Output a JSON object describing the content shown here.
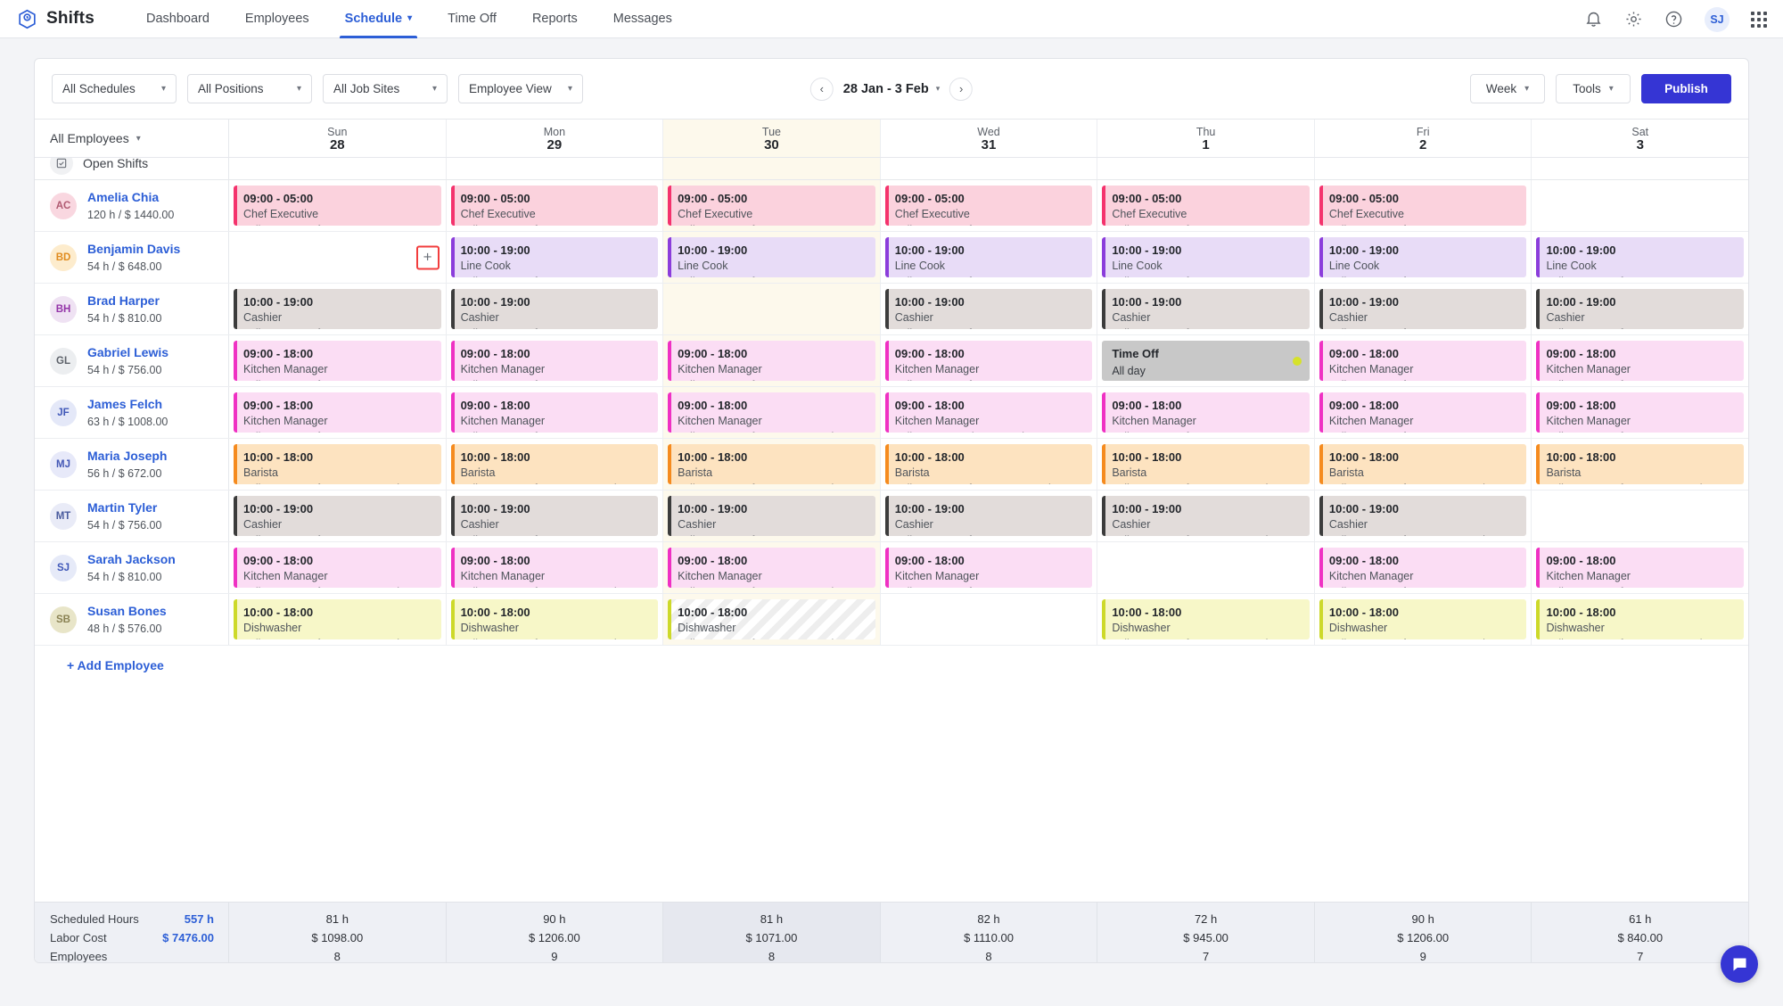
{
  "app": {
    "name": "Shifts",
    "logo_icon": "shifts-logo-icon"
  },
  "nav": {
    "items": [
      {
        "label": "Dashboard",
        "active": false,
        "caret": false
      },
      {
        "label": "Employees",
        "active": false,
        "caret": false
      },
      {
        "label": "Schedule",
        "active": true,
        "caret": true
      },
      {
        "label": "Time Off",
        "active": false,
        "caret": false
      },
      {
        "label": "Reports",
        "active": false,
        "caret": false
      },
      {
        "label": "Messages",
        "active": false,
        "caret": false
      }
    ],
    "right": {
      "bell_icon": "bell-icon",
      "settings_icon": "gear-icon",
      "help_icon": "help-circle-icon",
      "avatar_initials": "SJ",
      "apps_icon": "apps-grid-icon"
    }
  },
  "filters": {
    "schedules": "All Schedules",
    "positions": "All Positions",
    "job_sites": "All Job Sites",
    "view": "Employee View",
    "prev_icon": "chevron-left-icon",
    "next_icon": "chevron-right-icon",
    "date_range": "28 Jan - 3 Feb",
    "period": "Week",
    "tools": "Tools",
    "publish": "Publish"
  },
  "grid": {
    "employee_filter": "All Employees",
    "open_shifts_label": "Open Shifts",
    "add_employee": "+ Add Employee",
    "add_shift_icon": "plus-icon",
    "days": [
      {
        "name": "Sun",
        "date": "28",
        "today": false
      },
      {
        "name": "Mon",
        "date": "29",
        "today": false
      },
      {
        "name": "Tue",
        "date": "30",
        "today": true
      },
      {
        "name": "Wed",
        "date": "31",
        "today": false
      },
      {
        "name": "Thu",
        "date": "1",
        "today": false
      },
      {
        "name": "Fri",
        "date": "2",
        "today": false
      },
      {
        "name": "Sat",
        "date": "3",
        "today": false
      }
    ],
    "employees": [
      {
        "initials": "AC",
        "name": "Amelia Chia",
        "meta": "120 h / $ 1440.00",
        "avatar_bg": "#f9d7e0",
        "avatar_fg": "#b05a72",
        "cells": [
          {
            "time": "09:00 - 05:00",
            "position": "Chef Executive",
            "site": "Zylker Group of Restaurants, Aust",
            "bg": "#fbd2dd",
            "bar": "#f4336d"
          },
          {
            "time": "09:00 - 05:00",
            "position": "Chef Executive",
            "site": "Zylker Group of Restaurants, Aust",
            "bg": "#fbd2dd",
            "bar": "#f4336d"
          },
          {
            "time": "09:00 - 05:00",
            "position": "Chef Executive",
            "site": "Zylker Group of Restaurants, Aust",
            "bg": "#fbd2dd",
            "bar": "#f4336d"
          },
          {
            "time": "09:00 - 05:00",
            "position": "Chef Executive",
            "site": "Zylker Group of Restaurants, Aust",
            "bg": "#fbd2dd",
            "bar": "#f4336d"
          },
          {
            "time": "09:00 - 05:00",
            "position": "Chef Executive",
            "site": "Zylker Group of Restaurants, Aust",
            "bg": "#fbd2dd",
            "bar": "#f4336d"
          },
          {
            "time": "09:00 - 05:00",
            "position": "Chef Executive",
            "site": "Zylker Group of Restaurants, Aust",
            "bg": "#fbd2dd",
            "bar": "#f4336d"
          },
          null
        ]
      },
      {
        "initials": "BD",
        "name": "Benjamin Davis",
        "meta": "54 h / $ 648.00",
        "avatar_bg": "#fdeccd",
        "avatar_fg": "#e08b1e",
        "add_button_day": 0,
        "cells": [
          null,
          {
            "time": "10:00 - 19:00",
            "position": "Line Cook",
            "site": "Zylker Group of Restaurants, Aust",
            "bg": "#e8dcf7",
            "bar": "#8b3ddb"
          },
          {
            "time": "10:00 - 19:00",
            "position": "Line Cook",
            "site": "Zylker Group of Restaurants, Aust",
            "bg": "#e8dcf7",
            "bar": "#8b3ddb"
          },
          {
            "time": "10:00 - 19:00",
            "position": "Line Cook",
            "site": "Zylker Group of Restaurants, Aust",
            "bg": "#e8dcf7",
            "bar": "#8b3ddb"
          },
          {
            "time": "10:00 - 19:00",
            "position": "Line Cook",
            "site": "Zylker Group of Restaurants, Aust",
            "bg": "#e8dcf7",
            "bar": "#8b3ddb"
          },
          {
            "time": "10:00 - 19:00",
            "position": "Line Cook",
            "site": "Zylker Group of Restaurants, Aust",
            "bg": "#e8dcf7",
            "bar": "#8b3ddb"
          },
          {
            "time": "10:00 - 19:00",
            "position": "Line Cook",
            "site": "Zylker Group of Restaurants, Aust",
            "bg": "#e8dcf7",
            "bar": "#8b3ddb"
          }
        ]
      },
      {
        "initials": "BH",
        "name": "Brad Harper",
        "meta": "54 h / $ 810.00",
        "avatar_bg": "#efe2f3",
        "avatar_fg": "#9333a8",
        "cells": [
          {
            "time": "10:00 - 19:00",
            "position": "Cashier",
            "site": "Zylker Group of Restaurants, Aust",
            "bg": "#e2dcda",
            "bar": "#3c3c3c"
          },
          {
            "time": "10:00 - 19:00",
            "position": "Cashier",
            "site": "Zylker Group of Restaurants, Aust",
            "bg": "#e2dcda",
            "bar": "#3c3c3c"
          },
          null,
          {
            "time": "10:00 - 19:00",
            "position": "Cashier",
            "site": "Zylker Group of Restaurants, Aust",
            "bg": "#e2dcda",
            "bar": "#3c3c3c"
          },
          {
            "time": "10:00 - 19:00",
            "position": "Cashier",
            "site": "Zylker Group of Restaurants, Aust",
            "bg": "#e2dcda",
            "bar": "#3c3c3c"
          },
          {
            "time": "10:00 - 19:00",
            "position": "Cashier",
            "site": "Zylker Group of Restaurants, Aust",
            "bg": "#e2dcda",
            "bar": "#3c3c3c"
          },
          {
            "time": "10:00 - 19:00",
            "position": "Cashier",
            "site": "Zylker Group of Restaurants, Aust",
            "bg": "#e2dcda",
            "bar": "#3c3c3c"
          }
        ]
      },
      {
        "initials": "GL",
        "name": "Gabriel Lewis",
        "meta": "54 h / $ 756.00",
        "avatar_bg": "#eceef0",
        "avatar_fg": "#5c6169",
        "cells": [
          {
            "time": "09:00 - 18:00",
            "position": "Kitchen Manager",
            "site": "Zylker Group of Restaurants, Aust",
            "bg": "#fbddf4",
            "bar": "#ef31c3"
          },
          {
            "time": "09:00 - 18:00",
            "position": "Kitchen Manager",
            "site": "Zylker Group of Restaurants, Aust",
            "bg": "#fbddf4",
            "bar": "#ef31c3"
          },
          {
            "time": "09:00 - 18:00",
            "position": "Kitchen Manager",
            "site": "Zylker Group of Restaurants, Aust",
            "bg": "#fbddf4",
            "bar": "#ef31c3"
          },
          {
            "time": "09:00 - 18:00",
            "position": "Kitchen Manager",
            "site": "Zylker Group of Restaurants, Aust",
            "bg": "#fbddf4",
            "bar": "#ef31c3"
          },
          {
            "timeoff": true,
            "title": "Time Off",
            "subtitle": "All day"
          },
          {
            "time": "09:00 - 18:00",
            "position": "Kitchen Manager",
            "site": "Zylker Group of Restaurants, Aust",
            "bg": "#fbddf4",
            "bar": "#ef31c3"
          },
          {
            "time": "09:00 - 18:00",
            "position": "Kitchen Manager",
            "site": "Zylker Group of Restaurants, Aust",
            "bg": "#fbddf4",
            "bar": "#ef31c3"
          }
        ]
      },
      {
        "initials": "JF",
        "name": "James Felch",
        "meta": "63 h / $ 1008.00",
        "avatar_bg": "#e4e8f8",
        "avatar_fg": "#3f57b8",
        "cells": [
          {
            "time": "09:00 - 18:00",
            "position": "Kitchen Manager",
            "site": "Zylker Group of Restaurants, Aust",
            "bg": "#fbddf4",
            "bar": "#ef31c3"
          },
          {
            "time": "09:00 - 18:00",
            "position": "Kitchen Manager",
            "site": "Zylker Group of Restaurants, Aust",
            "bg": "#fbddf4",
            "bar": "#ef31c3"
          },
          {
            "time": "09:00 - 18:00",
            "position": "Kitchen Manager",
            "site": "Zylker Group of Restaurants, Plea:",
            "bg": "#fbddf4",
            "bar": "#ef31c3"
          },
          {
            "time": "09:00 - 18:00",
            "position": "Kitchen Manager",
            "site": "Zylker Corporation Pvt Ltd",
            "site2": "Zylker Group of Restaurants, Aust",
            "bg": "#fbddf4",
            "bar": "#ef31c3"
          },
          {
            "time": "09:00 - 18:00",
            "position": "Kitchen Manager",
            "site": "Zylker Group of Restaurants, Aust",
            "bg": "#fbddf4",
            "bar": "#ef31c3"
          },
          {
            "time": "09:00 - 18:00",
            "position": "Kitchen Manager",
            "site": "Zylker Group of Restaurants, Aust",
            "bg": "#fbddf4",
            "bar": "#ef31c3"
          },
          {
            "time": "09:00 - 18:00",
            "position": "Kitchen Manager",
            "site": "Zylker Group of Restaurants, Aust",
            "bg": "#fbddf4",
            "bar": "#ef31c3"
          }
        ]
      },
      {
        "initials": "MJ",
        "name": "Maria Joseph",
        "meta": "56 h / $ 672.00",
        "avatar_bg": "#e7e9f9",
        "avatar_fg": "#4256b5",
        "cells": [
          {
            "time": "10:00 - 18:00",
            "position": "Barista",
            "site": "Zylker Group of Restaurants, Plea:",
            "bg": "#fde3c0",
            "bar": "#f58b1f"
          },
          {
            "time": "10:00 - 18:00",
            "position": "Barista",
            "site": "Zylker Group of Restaurants, Plea:",
            "bg": "#fde3c0",
            "bar": "#f58b1f"
          },
          {
            "time": "10:00 - 18:00",
            "position": "Barista",
            "site": "Zylker Group of Restaurants, Plea:",
            "bg": "#fde3c0",
            "bar": "#f58b1f"
          },
          {
            "time": "10:00 - 18:00",
            "position": "Barista",
            "site": "Zylker Group of Restaurants, Plea:",
            "bg": "#fde3c0",
            "bar": "#f58b1f"
          },
          {
            "time": "10:00 - 18:00",
            "position": "Barista",
            "site": "Zylker Group of Restaurants, Plea:",
            "bg": "#fde3c0",
            "bar": "#f58b1f"
          },
          {
            "time": "10:00 - 18:00",
            "position": "Barista",
            "site": "Zylker Group of Restaurants, Plea:",
            "bg": "#fde3c0",
            "bar": "#f58b1f"
          },
          {
            "time": "10:00 - 18:00",
            "position": "Barista",
            "site": "Zylker Group of Restaurants, Plea:",
            "bg": "#fde3c0",
            "bar": "#f58b1f"
          }
        ]
      },
      {
        "initials": "MT",
        "name": "Martin Tyler",
        "meta": "54 h / $ 756.00",
        "avatar_bg": "#e9ebf7",
        "avatar_fg": "#4a5b9e",
        "cells": [
          {
            "time": "10:00 - 19:00",
            "position": "Cashier",
            "site": "Zylker Group of Restaurants, Aust",
            "bg": "#e2dcda",
            "bar": "#3c3c3c"
          },
          {
            "time": "10:00 - 19:00",
            "position": "Cashier",
            "site": "Zylker Group of Restaurants, Aust",
            "bg": "#e2dcda",
            "bar": "#3c3c3c"
          },
          {
            "time": "10:00 - 19:00",
            "position": "Cashier",
            "site": "Zylker Group of Restaurants, Aust",
            "bg": "#e2dcda",
            "bar": "#3c3c3c"
          },
          {
            "time": "10:00 - 19:00",
            "position": "Cashier",
            "site": "Zylker Group of Restaurants, Aust",
            "bg": "#e2dcda",
            "bar": "#3c3c3c"
          },
          {
            "time": "10:00 - 19:00",
            "position": "Cashier",
            "site": "Zylker Group of Restaurants, Plea:",
            "bg": "#e2dcda",
            "bar": "#3c3c3c"
          },
          {
            "time": "10:00 - 19:00",
            "position": "Cashier",
            "site": "Zylker Group of Restaurants, Plea:",
            "bg": "#e2dcda",
            "bar": "#3c3c3c"
          },
          null
        ]
      },
      {
        "initials": "SJ",
        "name": "Sarah Jackson",
        "meta": "54 h / $ 810.00",
        "avatar_bg": "#e6eaf8",
        "avatar_fg": "#3f57b8",
        "cells": [
          {
            "time": "09:00 - 18:00",
            "position": "Kitchen Manager",
            "site": "Zylker Group of Restaurants, Plea:",
            "bg": "#fbddf4",
            "bar": "#ef31c3"
          },
          {
            "time": "09:00 - 18:00",
            "position": "Kitchen Manager",
            "site": "Zylker Group of Restaurants, Plea:",
            "bg": "#fbddf4",
            "bar": "#ef31c3"
          },
          {
            "time": "09:00 - 18:00",
            "position": "Kitchen Manager",
            "site": "Zylker Group of Restaurants, Plea:",
            "bg": "#fbddf4",
            "bar": "#ef31c3"
          },
          {
            "time": "09:00 - 18:00",
            "position": "Kitchen Manager",
            "site": "Zylker Group of Restaurants, Aust",
            "bg": "#fbddf4",
            "bar": "#ef31c3"
          },
          null,
          {
            "time": "09:00 - 18:00",
            "position": "Kitchen Manager",
            "site": "Zylker Group of Restaurants, Aust",
            "bg": "#fbddf4",
            "bar": "#ef31c3"
          },
          {
            "time": "09:00 - 18:00",
            "position": "Kitchen Manager",
            "site": "Zylker Group of Restaurants, Aust",
            "bg": "#fbddf4",
            "bar": "#ef31c3"
          }
        ]
      },
      {
        "initials": "SB",
        "name": "Susan Bones",
        "meta": "48 h / $ 576.00",
        "avatar_bg": "#e8e5c8",
        "avatar_fg": "#8a8253",
        "cells": [
          {
            "time": "10:00 - 18:00",
            "position": "Dishwasher",
            "site": "Zylker Group of Restaurants, Plea:",
            "bg": "#f7f7c8",
            "bar": "#cdd92a"
          },
          {
            "time": "10:00 - 18:00",
            "position": "Dishwasher",
            "site": "Zylker Group of Restaurants, Plea:",
            "bg": "#f7f7c8",
            "bar": "#cdd92a"
          },
          {
            "time": "10:00 - 18:00",
            "position": "Dishwasher",
            "site": "Zylker Group of Restaurants, Plea:",
            "bg": "#ffffff",
            "bar": "#cdd92a",
            "stripe": true
          },
          null,
          {
            "time": "10:00 - 18:00",
            "position": "Dishwasher",
            "site": "Zylker Group of Restaurants, Plea:",
            "bg": "#f7f7c8",
            "bar": "#cdd92a"
          },
          {
            "time": "10:00 - 18:00",
            "position": "Dishwasher",
            "site": "Zylker Group of Restaurants, Plea:",
            "bg": "#f7f7c8",
            "bar": "#cdd92a"
          },
          {
            "time": "10:00 - 18:00",
            "position": "Dishwasher",
            "site": "Zylker Group of Restaurants, Plea:",
            "bg": "#f7f7c8",
            "bar": "#cdd92a"
          }
        ]
      }
    ]
  },
  "footer": {
    "labels": {
      "hours": "Scheduled Hours",
      "cost": "Labor Cost",
      "employees": "Employees"
    },
    "totals": {
      "hours": "557 h",
      "cost": "$ 7476.00"
    },
    "columns": [
      {
        "hours": "81 h",
        "cost": "$ 1098.00",
        "employees": "8",
        "today": false
      },
      {
        "hours": "90 h",
        "cost": "$ 1206.00",
        "employees": "9",
        "today": false
      },
      {
        "hours": "81 h",
        "cost": "$ 1071.00",
        "employees": "8",
        "today": true
      },
      {
        "hours": "82 h",
        "cost": "$ 1110.00",
        "employees": "8",
        "today": false
      },
      {
        "hours": "72 h",
        "cost": "$ 945.00",
        "employees": "7",
        "today": false
      },
      {
        "hours": "90 h",
        "cost": "$ 1206.00",
        "employees": "9",
        "today": false
      },
      {
        "hours": "61 h",
        "cost": "$ 840.00",
        "employees": "7",
        "today": false
      }
    ]
  },
  "chat": {
    "icon": "chat-bubble-icon"
  }
}
